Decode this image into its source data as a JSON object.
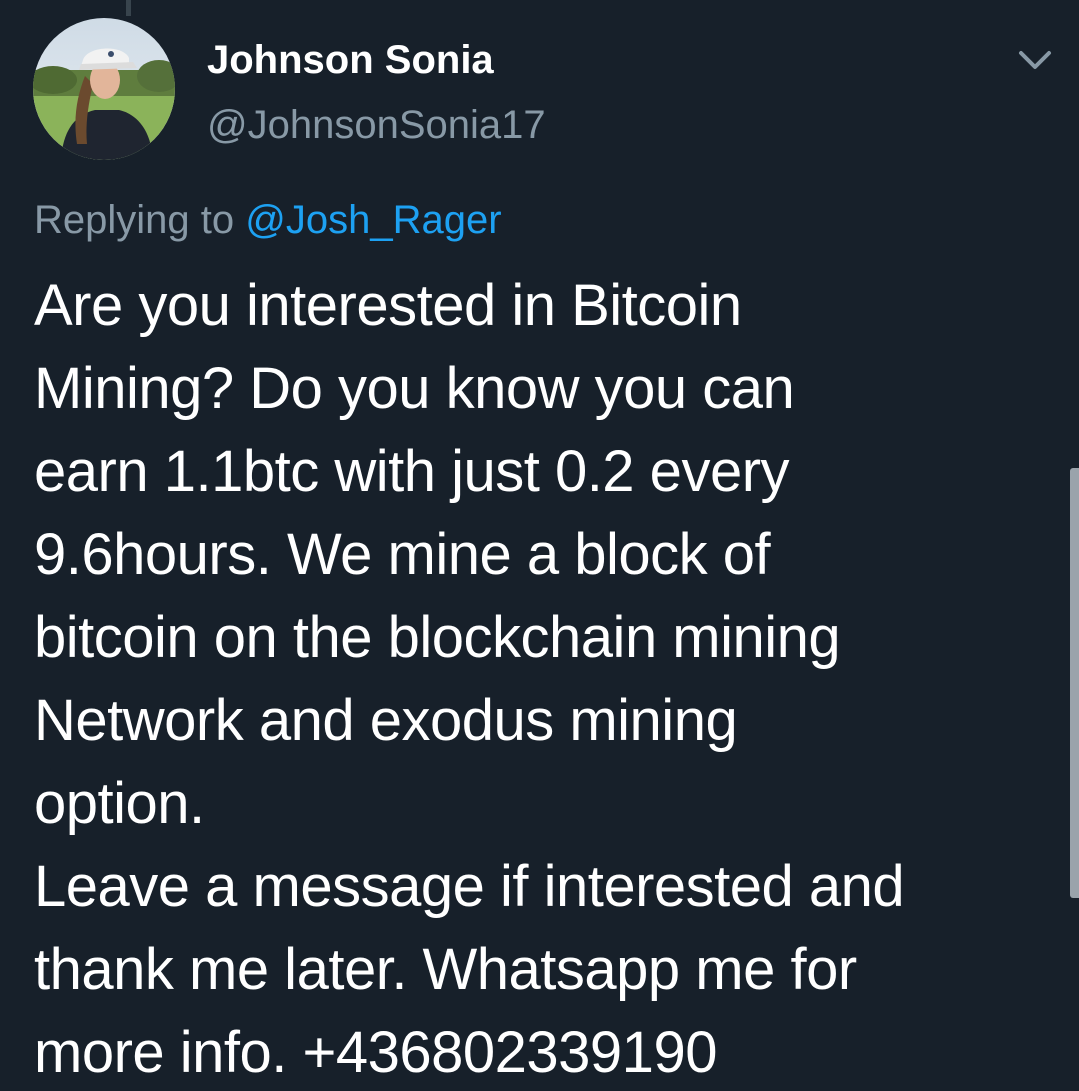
{
  "tweet": {
    "author": {
      "display_name": "Johnson Sonia",
      "handle": "@JohnsonSonia17"
    },
    "reply": {
      "prefix": "Replying to",
      "mention": "@Josh_Rager"
    },
    "text_lines": [
      "Are you interested in Bitcoin",
      "Mining? Do you know you can",
      "earn 1.1btc with just 0.2 every",
      "9.6hours. We mine a block of",
      "bitcoin on the blockchain mining",
      "Network and exodus mining",
      "option.",
      "Leave a message if interested and",
      "thank me later. Whatsapp me for",
      "more info. +436802339190"
    ],
    "menu_icon": "chevron-down-icon"
  },
  "colors": {
    "background": "#17202a",
    "primary_text": "#ffffff",
    "secondary_text": "#8899a6",
    "link": "#1da1f2"
  }
}
